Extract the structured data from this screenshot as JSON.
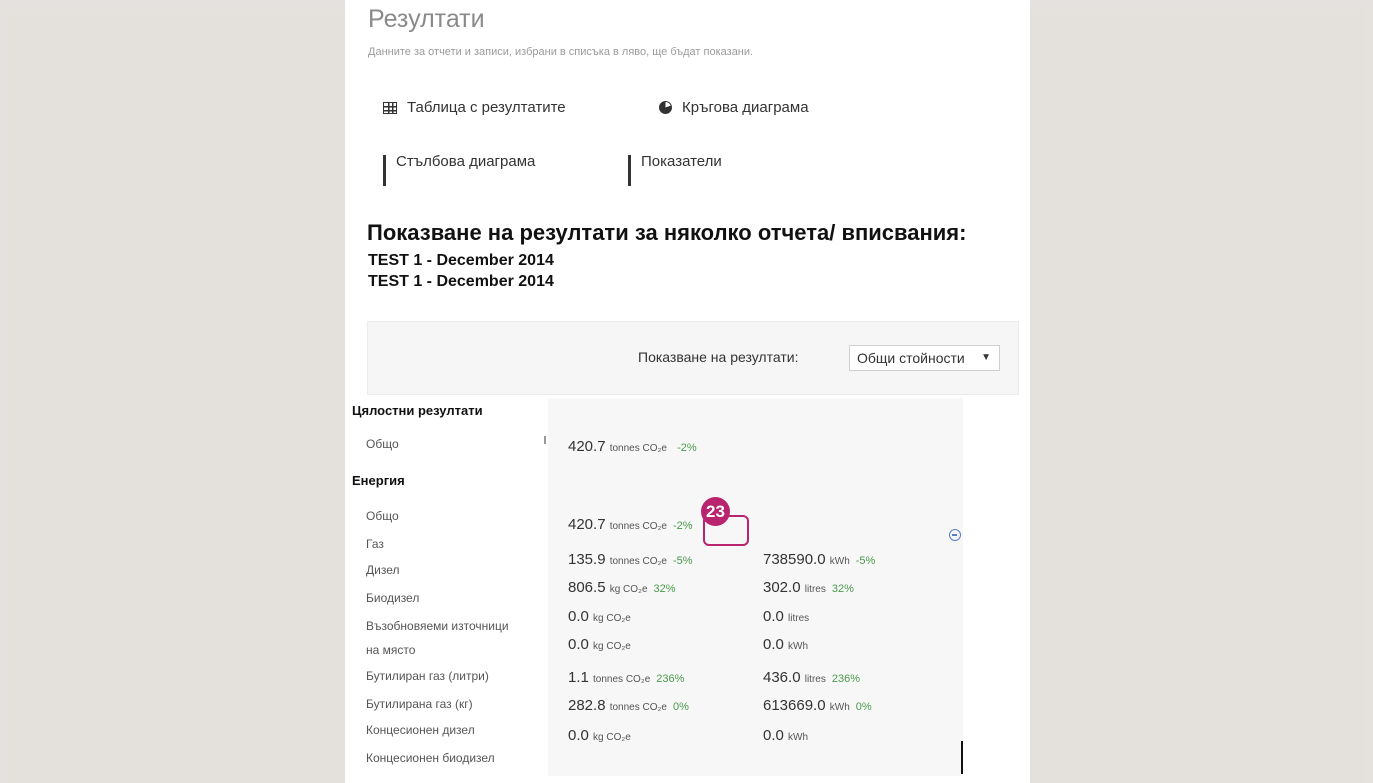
{
  "page": {
    "title": "Резултати",
    "subtitle": "Данните за отчети и записи, избрани в списъка в ляво, ще бъдат показани."
  },
  "views": {
    "table": "Таблица с резултатите",
    "pie": "Кръгова диаграма",
    "bar": "Стълбова диаграма",
    "indicators": "Показатели"
  },
  "heading": "Показване на резултати за няколко отчета/ вписвания:",
  "reports": [
    "TEST 1 - December 2014",
    "TEST 1 - December 2014"
  ],
  "filter": {
    "label": "Показване на резултати:",
    "selected": "Общи стойности"
  },
  "badge": "23",
  "results": {
    "overall_heading": "Цялостни резултати",
    "overall_total_label": "Общо",
    "overall_total": {
      "value": "420.7",
      "unit": "tonnes CO₂e",
      "pct": "-2%"
    },
    "energy_heading": "Енергия",
    "rows": [
      {
        "label": "Общо",
        "v1": "420.7",
        "u1": "tonnes CO₂e",
        "p1": "-2%",
        "v2": "",
        "u2": "",
        "p2": ""
      },
      {
        "label": "Газ",
        "v1": "135.9",
        "u1": "tonnes CO₂e",
        "p1": "-5%",
        "v2": "738590.0",
        "u2": "kWh",
        "p2": "-5%"
      },
      {
        "label": "Дизел",
        "v1": "806.5",
        "u1": "kg CO₂e",
        "p1": "32%",
        "v2": "302.0",
        "u2": "litres",
        "p2": "32%"
      },
      {
        "label": "Биодизел",
        "v1": "0.0",
        "u1": "kg CO₂e",
        "p1": "",
        "v2": "0.0",
        "u2": "litres",
        "p2": ""
      },
      {
        "label": "Възобновяеми източници",
        "v1": "0.0",
        "u1": "kg CO₂e",
        "p1": "",
        "v2": "0.0",
        "u2": "kWh",
        "p2": ""
      },
      {
        "label": "на място",
        "v1": "",
        "u1": "",
        "p1": "",
        "v2": "",
        "u2": "",
        "p2": ""
      },
      {
        "label": "Бутилиран газ (литри)",
        "v1": "1.1",
        "u1": "tonnes CO₂e",
        "p1": "236%",
        "v2": "436.0",
        "u2": "litres",
        "p2": "236%"
      },
      {
        "label": "Бутилирана газ (кг)",
        "v1": "282.8",
        "u1": "tonnes CO₂e",
        "p1": "0%",
        "v2": "613669.0",
        "u2": "kWh",
        "p2": "0%"
      },
      {
        "label": "Концесионен дизел",
        "v1": "0.0",
        "u1": "kg CO₂e",
        "p1": "",
        "v2": "0.0",
        "u2": "kWh",
        "p2": ""
      },
      {
        "label": "Концесионен биодизел",
        "v1": "",
        "u1": "",
        "p1": "",
        "v2": "",
        "u2": "",
        "p2": ""
      }
    ]
  },
  "colors": {
    "accent": "#b8256e",
    "positive": "#4a9a4a",
    "link": "#5a7fd0"
  }
}
